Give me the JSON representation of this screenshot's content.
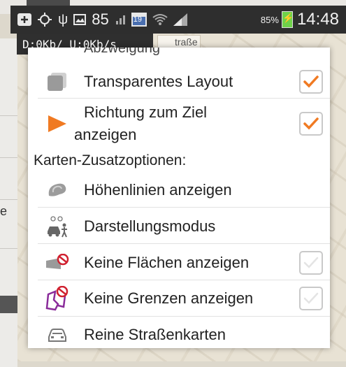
{
  "status_bar": {
    "notification_count": "85",
    "battery_percent": "85%",
    "time": "14:48",
    "calendar_day": "19"
  },
  "netspeed": "D:0Kb/ U:0Kb/s",
  "background": {
    "left_text": "e",
    "map_street": "traße"
  },
  "menu": {
    "cut_heading": "Abzweigung",
    "items": [
      {
        "label": "Transparentes Layout",
        "checked": true
      },
      {
        "label": "Richtung zum Ziel",
        "label2": "anzeigen",
        "checked": true
      }
    ],
    "section_title": "Karten-Zusatzoptionen:",
    "extra": [
      {
        "label": "Höhenlinien anzeigen"
      },
      {
        "label": "Darstellungsmodus"
      },
      {
        "label": "Keine Flächen anzeigen",
        "checked": false
      },
      {
        "label": "Keine Grenzen anzeigen",
        "checked": false
      },
      {
        "label": "Reine Straßenkarten"
      }
    ]
  },
  "colors": {
    "accent": "#f07a22",
    "checkbox_border": "#c9c9c9",
    "statusbar": "#2e2e2e"
  }
}
